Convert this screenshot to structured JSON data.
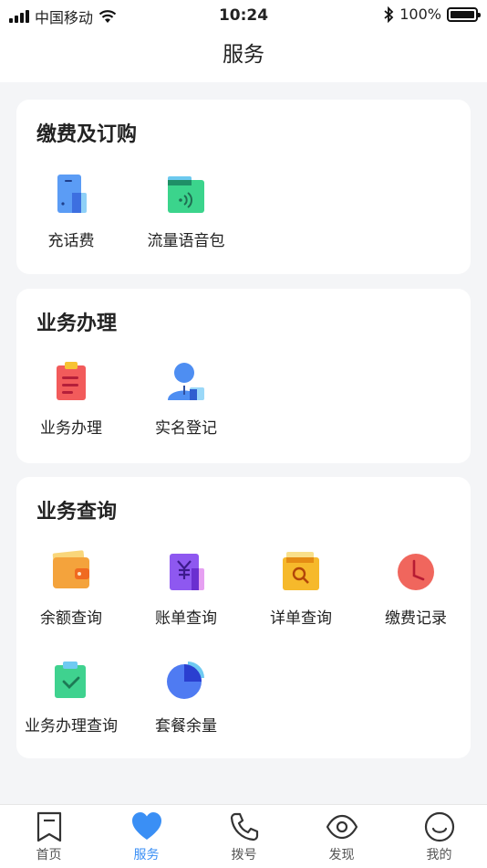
{
  "status": {
    "carrier": "中国移动",
    "time": "10:24",
    "battery": "100%"
  },
  "header": {
    "title": "服务"
  },
  "sections": [
    {
      "title": "缴费及订购",
      "items": [
        {
          "label": "充话费",
          "icon": "phone-recharge-icon"
        },
        {
          "label": "流量语音包",
          "icon": "data-voice-package-icon"
        }
      ]
    },
    {
      "title": "业务办理",
      "items": [
        {
          "label": "业务办理",
          "icon": "clipboard-icon"
        },
        {
          "label": "实名登记",
          "icon": "user-id-icon"
        }
      ]
    },
    {
      "title": "业务查询",
      "items": [
        {
          "label": "余额查询",
          "icon": "wallet-icon"
        },
        {
          "label": "账单查询",
          "icon": "yuan-bill-icon"
        },
        {
          "label": "详单查询",
          "icon": "search-folder-icon"
        },
        {
          "label": "缴费记录",
          "icon": "clock-icon"
        },
        {
          "label": "业务办理查询",
          "icon": "check-clipboard-icon"
        },
        {
          "label": "套餐余量",
          "icon": "pie-chart-icon"
        }
      ]
    }
  ],
  "tabs": [
    {
      "label": "首页",
      "icon": "bookmark-icon",
      "active": false
    },
    {
      "label": "服务",
      "icon": "heart-icon",
      "active": true
    },
    {
      "label": "拨号",
      "icon": "phone-icon",
      "active": false
    },
    {
      "label": "发现",
      "icon": "eye-icon",
      "active": false
    },
    {
      "label": "我的",
      "icon": "smile-icon",
      "active": false
    }
  ],
  "colors": {
    "accent": "#3a8ff5",
    "background": "#f4f5f7",
    "card": "#ffffff"
  }
}
